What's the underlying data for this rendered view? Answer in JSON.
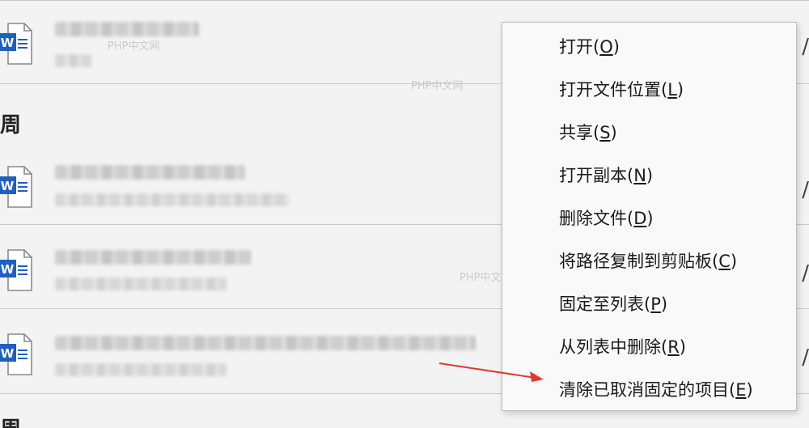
{
  "sections": {
    "week_heading": "周",
    "bottom_heading": "周"
  },
  "right_edge_text": "/",
  "watermark_text": "PHP中文网",
  "context_menu": {
    "items": [
      {
        "label": "打开",
        "accel": "O"
      },
      {
        "label": "打开文件位置",
        "accel": "L"
      },
      {
        "label": "共享",
        "accel": "S"
      },
      {
        "label": "打开副本",
        "accel": "N"
      },
      {
        "label": "删除文件",
        "accel": "D"
      },
      {
        "label": "将路径复制到剪贴板",
        "accel": "C"
      },
      {
        "label": "固定至列表",
        "accel": "P"
      },
      {
        "label": "从列表中删除",
        "accel": "R"
      },
      {
        "label": "清除已取消固定的项目",
        "accel": "E"
      }
    ]
  },
  "colors": {
    "arrow": "#e03a2f",
    "word_blue": "#1f5fbf"
  },
  "icons": {
    "file": "word-document-icon"
  }
}
